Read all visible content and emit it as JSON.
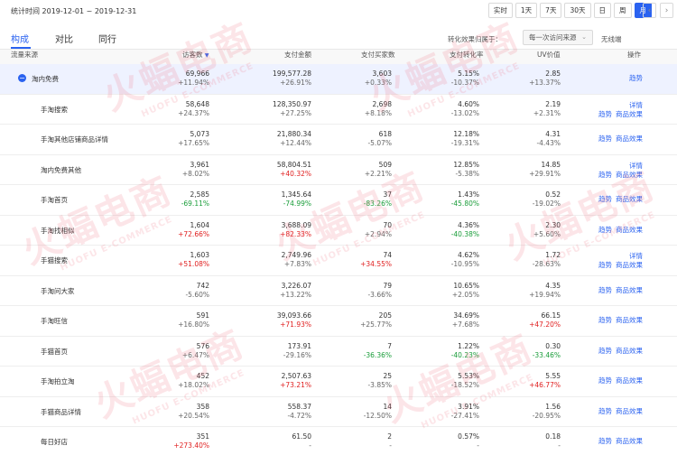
{
  "header": {
    "stat_time_label": "统计时间 2019-12-01 ~ 2019-12-31",
    "range_buttons": [
      "实时",
      "1天",
      "7天",
      "30天",
      "日",
      "周",
      "月"
    ],
    "active_range": "月",
    "prev_icon": "chevron-left-icon",
    "next_icon": "chevron-right-icon"
  },
  "tabs": {
    "items": [
      "构成",
      "对比",
      "同行"
    ],
    "active": "构成",
    "attribution_label": "转化效果归属于：",
    "attribution_value": "每一次访问来源",
    "wireless_label": "无线端"
  },
  "table": {
    "headers": {
      "source": "流量来源",
      "visitors": "访客数",
      "amount": "支付金额",
      "buyers": "支付买家数",
      "conversion": "支付转化率",
      "uv_value": "UV价值",
      "ops": "操作"
    },
    "rows": [
      {
        "source": "淘内免费",
        "visitors": "69,966",
        "visitors_chg": "+11.94%",
        "amount": "199,577.28",
        "amount_chg": "+26.91%",
        "buyers": "3,603",
        "buyers_chg": "+0.33%",
        "conversion": "5.15%",
        "conversion_chg": "-10.37%",
        "uv": "2.85",
        "uv_chg": "+13.37%",
        "ops": [
          "趋势"
        ],
        "expanded": true
      },
      {
        "source": "手淘搜索",
        "visitors": "58,648",
        "visitors_chg": "+24.37%",
        "amount": "128,350.97",
        "amount_chg": "+27.25%",
        "buyers": "2,698",
        "buyers_chg": "+8.18%",
        "conversion": "4.60%",
        "conversion_chg": "-13.02%",
        "uv": "2.19",
        "uv_chg": "+2.31%",
        "ops": [
          "详情",
          "趋势",
          "商品效果"
        ]
      },
      {
        "source": "手淘其他店铺商品详情",
        "visitors": "5,073",
        "visitors_chg": "+17.65%",
        "amount": "21,880.34",
        "amount_chg": "+12.44%",
        "buyers": "618",
        "buyers_chg": "-5.07%",
        "conversion": "12.18%",
        "conversion_chg": "-19.31%",
        "uv": "4.31",
        "uv_chg": "-4.43%",
        "ops": [
          "趋势",
          "商品效果"
        ]
      },
      {
        "source": "淘内免费其他",
        "visitors": "3,961",
        "visitors_chg": "+8.02%",
        "amount": "58,804.51",
        "amount_chg": "+40.32%",
        "buyers": "509",
        "buyers_chg": "+2.21%",
        "conversion": "12.85%",
        "conversion_chg": "-5.38%",
        "uv": "14.85",
        "uv_chg": "+29.91%",
        "ops": [
          "详情",
          "趋势",
          "商品效果"
        ]
      },
      {
        "source": "手淘首页",
        "visitors": "2,585",
        "visitors_chg": "-69.11%",
        "amount": "1,345.64",
        "amount_chg": "-74.99%",
        "buyers": "37",
        "buyers_chg": "-83.26%",
        "conversion": "1.43%",
        "conversion_chg": "-45.80%",
        "uv": "0.52",
        "uv_chg": "-19.02%",
        "ops": [
          "趋势",
          "商品效果"
        ]
      },
      {
        "source": "手淘找相似",
        "visitors": "1,604",
        "visitors_chg": "+72.66%",
        "amount": "3,688.09",
        "amount_chg": "+82.33%",
        "buyers": "70",
        "buyers_chg": "+2.94%",
        "conversion": "4.36%",
        "conversion_chg": "-40.38%",
        "uv": "2.30",
        "uv_chg": "+5.60%",
        "ops": [
          "趋势",
          "商品效果"
        ]
      },
      {
        "source": "手猫搜索",
        "visitors": "1,603",
        "visitors_chg": "+51.08%",
        "amount": "2,749.96",
        "amount_chg": "+7.83%",
        "buyers": "74",
        "buyers_chg": "+34.55%",
        "conversion": "4.62%",
        "conversion_chg": "-10.95%",
        "uv": "1.72",
        "uv_chg": "-28.63%",
        "ops": [
          "详情",
          "趋势",
          "商品效果"
        ]
      },
      {
        "source": "手淘问大家",
        "visitors": "742",
        "visitors_chg": "-5.60%",
        "amount": "3,226.07",
        "amount_chg": "+13.22%",
        "buyers": "79",
        "buyers_chg": "-3.66%",
        "conversion": "10.65%",
        "conversion_chg": "+2.05%",
        "uv": "4.35",
        "uv_chg": "+19.94%",
        "ops": [
          "趋势",
          "商品效果"
        ]
      },
      {
        "source": "手淘旺信",
        "visitors": "591",
        "visitors_chg": "+16.80%",
        "amount": "39,093.66",
        "amount_chg": "+71.93%",
        "buyers": "205",
        "buyers_chg": "+25.77%",
        "conversion": "34.69%",
        "conversion_chg": "+7.68%",
        "uv": "66.15",
        "uv_chg": "+47.20%",
        "ops": [
          "趋势",
          "商品效果"
        ]
      },
      {
        "source": "手猫首页",
        "visitors": "576",
        "visitors_chg": "+6.47%",
        "amount": "173.91",
        "amount_chg": "-29.16%",
        "buyers": "7",
        "buyers_chg": "-36.36%",
        "conversion": "1.22%",
        "conversion_chg": "-40.23%",
        "uv": "0.30",
        "uv_chg": "-33.46%",
        "ops": [
          "趋势",
          "商品效果"
        ]
      },
      {
        "source": "手淘拍立淘",
        "visitors": "452",
        "visitors_chg": "+18.02%",
        "amount": "2,507.63",
        "amount_chg": "+73.21%",
        "buyers": "25",
        "buyers_chg": "-3.85%",
        "conversion": "5.53%",
        "conversion_chg": "-18.52%",
        "uv": "5.55",
        "uv_chg": "+46.77%",
        "ops": [
          "趋势",
          "商品效果"
        ]
      },
      {
        "source": "手猫商品详情",
        "visitors": "358",
        "visitors_chg": "+20.54%",
        "amount": "558.37",
        "amount_chg": "-4.72%",
        "buyers": "14",
        "buyers_chg": "-12.50%",
        "conversion": "3.91%",
        "conversion_chg": "-27.41%",
        "uv": "1.56",
        "uv_chg": "-20.95%",
        "ops": [
          "趋势",
          "商品效果"
        ]
      },
      {
        "source": "每日好店",
        "visitors": "351",
        "visitors_chg": "+273.40%",
        "amount": "61.50",
        "amount_chg": "-",
        "buyers": "2",
        "buyers_chg": "-",
        "conversion": "0.57%",
        "conversion_chg": "-",
        "uv": "0.18",
        "uv_chg": "-",
        "ops": [
          "趋势",
          "商品效果"
        ]
      }
    ]
  },
  "watermark": {
    "text": "火蝠电商",
    "subtext": "HUOFU E-COMMERCE"
  },
  "colors": {
    "accent": "#2a62f0",
    "increase": "#e02020",
    "decrease": "#1a9d3a",
    "watermark": "#ec6e82"
  }
}
